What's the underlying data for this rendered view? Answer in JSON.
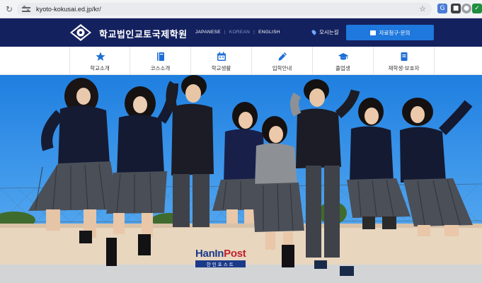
{
  "browser": {
    "url": "kyoto-kokusai.ed.jp/kr/"
  },
  "header": {
    "school_name": "학교법인교토국제학원",
    "languages": [
      {
        "label": "JAPANESE"
      },
      {
        "label": "KOREAN"
      },
      {
        "label": "ENGLISH"
      }
    ],
    "access_label": "오시는길",
    "request_button": "자료청구·문의"
  },
  "nav": {
    "items": [
      {
        "label": "학교소개",
        "icon": "star-icon"
      },
      {
        "label": "코스소개",
        "icon": "book-icon"
      },
      {
        "label": "학교생활",
        "icon": "calendar-icon"
      },
      {
        "label": "입학안내",
        "icon": "pencil-icon"
      },
      {
        "label": "졸업생",
        "icon": "graduation-cap-icon"
      },
      {
        "label": "재학생·보호자",
        "icon": "notebook-icon"
      }
    ]
  },
  "watermark": {
    "main_part1": "HanIn",
    "main_part2": "Post",
    "sub": "한인포스트"
  },
  "colors": {
    "navy": "#14215f",
    "accent_blue": "#1e78dd",
    "sky": "#2f8fe6"
  }
}
